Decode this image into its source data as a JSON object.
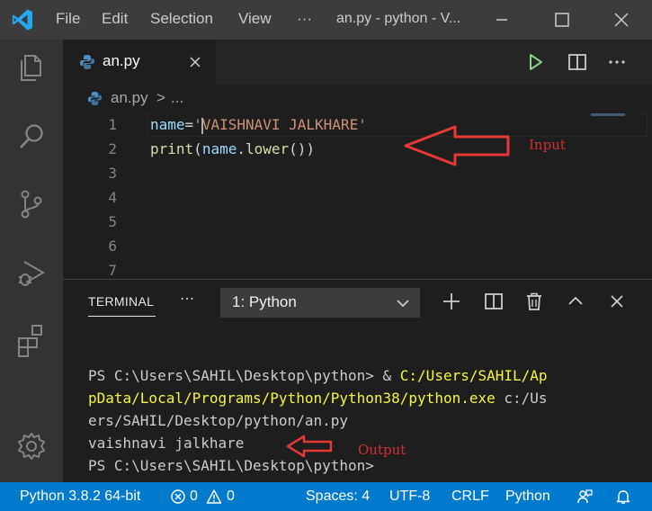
{
  "menu": {
    "file": "File",
    "edit": "Edit",
    "selection": "Selection",
    "view": "View",
    "more": "···"
  },
  "window": {
    "title": "an.py - python - V..."
  },
  "tab": {
    "label": "an.py"
  },
  "breadcrumb": {
    "file": "an.py",
    "separator": ">",
    "more": "..."
  },
  "editor": {
    "line_numbers": [
      "1",
      "2",
      "3",
      "4",
      "5",
      "6",
      "7"
    ],
    "line1": {
      "var": "name",
      "eq": "=",
      "str": "'VAISHNAVI JALKHARE'"
    },
    "line2": {
      "fn": "print",
      "open": "(",
      "obj": "name",
      "dot": ".",
      "method": "lower",
      "close": "())"
    }
  },
  "annotations": {
    "input": "Input",
    "output": "Output",
    "color": "#e53935"
  },
  "panel": {
    "tab": "TERMINAL",
    "more": "···",
    "terminal_select": "1: Python"
  },
  "terminal": {
    "line1_prompt": "PS C:\\Users\\SAHIL\\Desktop\\python> ",
    "line1_amp": "& ",
    "line1_path": "C:/Users/SAHIL/Ap",
    "line2_path": "pData/Local/Programs/Python/Python38/python.exe",
    "line2_rest": " c:/Us",
    "line3": "ers/SAHIL/Desktop/python/an.py",
    "line4": "vaishnavi jalkhare",
    "line5": "PS C:\\Users\\SAHIL\\Desktop\\python>"
  },
  "status": {
    "interpreter": "Python 3.8.2 64-bit",
    "errors": "0",
    "warnings": "0",
    "spaces": "Spaces: 4",
    "encoding": "UTF-8",
    "eol": "CRLF",
    "language": "Python"
  },
  "colors": {
    "statusbar": "#007acc",
    "activitybar": "#333333",
    "titlebar": "#3c3c3c",
    "editor": "#1e1e1e"
  }
}
